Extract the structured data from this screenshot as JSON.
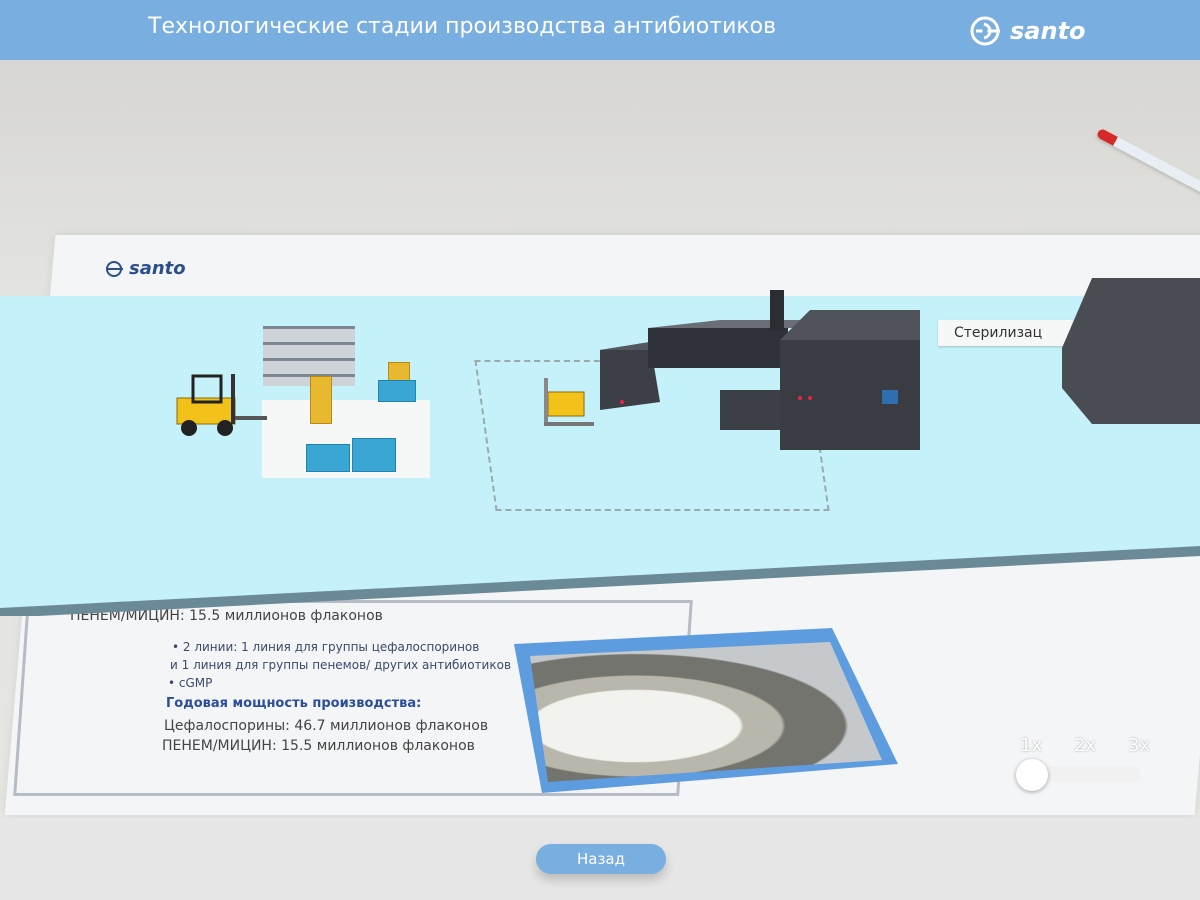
{
  "header": {
    "title": "Технологические стадии производства антибиотиков",
    "brand": "santo"
  },
  "scene": {
    "paper_brand": "santo",
    "station_label": "Стерилизац",
    "document_lines": [
      "ПЕНЕМ/МИЦИН: 15.5 миллионов флаконов",
      "• 2 линии: 1 линия для группы цефалоспоринов",
      "  и 1 линия   для группы пенемов/ других антибиотиков",
      "• cGMP",
      "Годовая мощность производства:",
      "Цефалоспорины: 46.7 миллионов флаконов",
      "ПЕНЕМ/МИЦИН: 15.5 миллионов флаконов"
    ]
  },
  "zoom": {
    "options": [
      "1x",
      "2x",
      "3x"
    ],
    "selected": "1x"
  },
  "footer": {
    "back_label": "Назад"
  },
  "colors": {
    "accent": "#79aee0",
    "platform": "#c5f1fb"
  }
}
